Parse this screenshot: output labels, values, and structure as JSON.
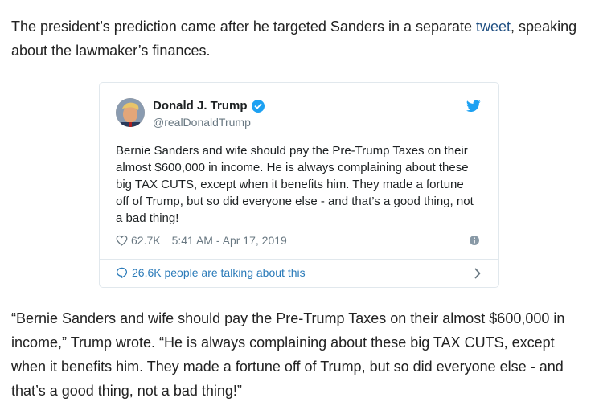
{
  "article": {
    "intro_before_link": "The president’s prediction came after he targeted Sanders in a separate ",
    "intro_link": "tweet",
    "intro_after_link": ", speaking about the lawmaker’s finances.",
    "quote_paragraph": "“Bernie Sanders and wife should pay the Pre-Trump Taxes on their almost $600,000 in income,” Trump wrote. “He is always complaining about these big TAX CUTS, except when it benefits him. They made a fortune off of Trump, but so did everyone else - and that’s a good thing, not a bad thing!”"
  },
  "tweet": {
    "author_name": "Donald J. Trump",
    "handle": "@realDonaldTrump",
    "text": "Bernie Sanders and wife should pay the Pre-Trump Taxes on their almost $600,000 in income. He is always complaining about these big TAX CUTS, except when it benefits him. They made a fortune off of Trump, but so did everyone else - and that’s a good thing, not a bad thing!",
    "likes": "62.7K",
    "timestamp": "5:41 AM - Apr 17, 2019",
    "talking": "26.6K people are talking about this",
    "icons": {
      "verified": "verified-badge-icon",
      "logo": "twitter-bird-icon",
      "like": "heart-icon",
      "info": "info-icon",
      "reply": "speech-bubble-icon",
      "more": "chevron-right-icon"
    },
    "colors": {
      "accent": "#1da1f2",
      "link": "#2b7bb9",
      "muted": "#697882"
    }
  }
}
